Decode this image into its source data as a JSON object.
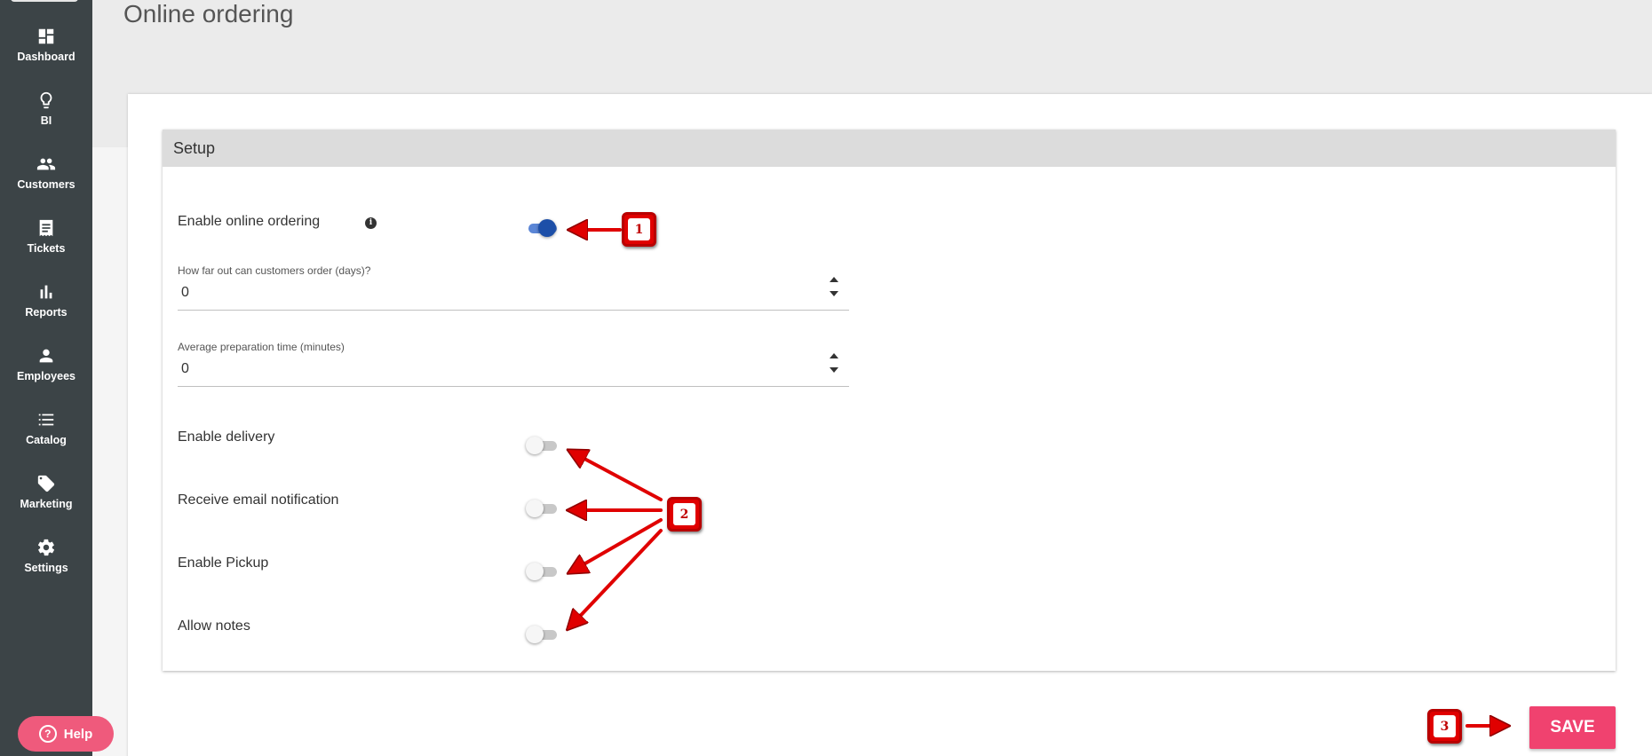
{
  "page": {
    "title": "Online ordering"
  },
  "sidebar": {
    "items": [
      {
        "label": "Dashboard",
        "icon": "dashboard-icon"
      },
      {
        "label": "BI",
        "icon": "lightbulb-icon"
      },
      {
        "label": "Customers",
        "icon": "people-icon"
      },
      {
        "label": "Tickets",
        "icon": "receipt-icon"
      },
      {
        "label": "Reports",
        "icon": "bar-chart-icon"
      },
      {
        "label": "Employees",
        "icon": "person-icon"
      },
      {
        "label": "Catalog",
        "icon": "list-icon"
      },
      {
        "label": "Marketing",
        "icon": "tag-icon"
      },
      {
        "label": "Settings",
        "icon": "gear-icon"
      }
    ],
    "help_label": "Help",
    "help_icon": "question-circle-icon"
  },
  "setup": {
    "title": "Setup",
    "enable_online_ordering": {
      "label": "Enable online ordering",
      "on": true,
      "info_icon": "info-icon"
    },
    "order_days": {
      "label": "How far out can customers order (days)?",
      "value": "0"
    },
    "prep_time": {
      "label": "Average preparation time (minutes)",
      "value": "0"
    },
    "toggles": [
      {
        "label": "Enable delivery",
        "on": false
      },
      {
        "label": "Receive email notification",
        "on": false
      },
      {
        "label": "Enable Pickup",
        "on": false
      },
      {
        "label": "Allow notes",
        "on": false
      }
    ]
  },
  "actions": {
    "save_label": "SAVE"
  },
  "annotations": {
    "badges": [
      "1",
      "2",
      "3"
    ],
    "color": "#e00000"
  },
  "colors": {
    "sidebar": "#3c4447",
    "accent_pink": "#f0426f",
    "toggle_on": "#1d4fa8"
  }
}
